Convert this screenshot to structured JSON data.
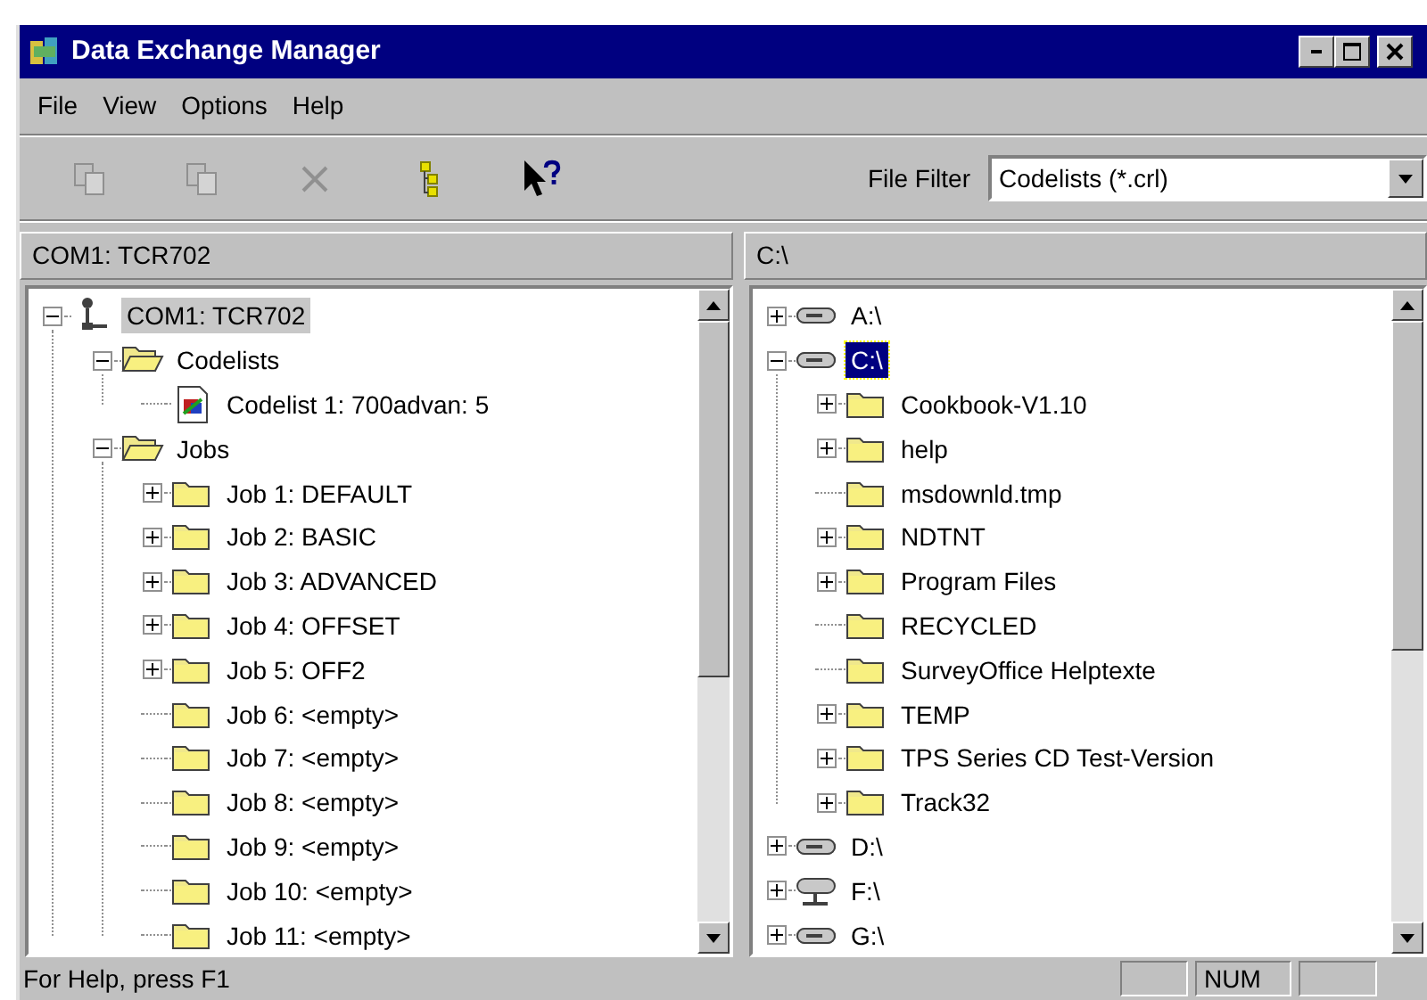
{
  "window": {
    "title": "Data Exchange Manager"
  },
  "menu": [
    {
      "label": "File"
    },
    {
      "label": "View"
    },
    {
      "label": "Options"
    },
    {
      "label": "Help"
    }
  ],
  "toolbar": [
    {
      "kind": "copy-left",
      "disabled": true
    },
    {
      "kind": "copy-right",
      "disabled": true
    },
    {
      "kind": "delete",
      "disabled": true
    },
    {
      "kind": "tree",
      "disabled": false
    },
    {
      "kind": "help",
      "disabled": false
    }
  ],
  "file_filter": {
    "label": "File Filter",
    "value": "Codelists (*.crl)"
  },
  "panes": [
    {
      "header": "COM1: TCR702",
      "focused": false,
      "tree": [
        {
          "label": "COM1: TCR702",
          "kind": "device",
          "selected": true,
          "expanded": true,
          "children": [
            {
              "label": "Codelists",
              "kind": "open-folder",
              "selected": false,
              "expanded": true,
              "children": [
                {
                  "label": "Codelist 1: 700advan: 5",
                  "kind": "codelist",
                  "selected": false
                }
              ]
            },
            {
              "label": "Jobs",
              "kind": "open-folder",
              "selected": false,
              "expanded": true,
              "children": [
                {
                  "label": "Job 1: DEFAULT",
                  "kind": "folder",
                  "selected": false,
                  "expanded": false
                },
                {
                  "label": "Job 2: BASIC",
                  "kind": "folder",
                  "selected": false,
                  "expanded": false
                },
                {
                  "label": "Job 3: ADVANCED",
                  "kind": "folder",
                  "selected": false,
                  "expanded": false
                },
                {
                  "label": "Job 4: OFFSET",
                  "kind": "folder",
                  "selected": false,
                  "expanded": false
                },
                {
                  "label": "Job 5: OFF2",
                  "kind": "folder",
                  "selected": false,
                  "expanded": false
                },
                {
                  "label": "Job 6: <empty>",
                  "kind": "folder",
                  "selected": false
                },
                {
                  "label": "Job 7: <empty>",
                  "kind": "folder",
                  "selected": false
                },
                {
                  "label": "Job 8: <empty>",
                  "kind": "folder",
                  "selected": false
                },
                {
                  "label": "Job 9: <empty>",
                  "kind": "folder",
                  "selected": false
                },
                {
                  "label": "Job 10: <empty>",
                  "kind": "folder",
                  "selected": false
                },
                {
                  "label": "Job 11: <empty>",
                  "kind": "folder",
                  "selected": false
                }
              ]
            }
          ]
        }
      ]
    },
    {
      "header": "C:\\",
      "focused": true,
      "tree": [
        {
          "label": "A:\\",
          "kind": "drive",
          "selected": false,
          "expanded": false
        },
        {
          "label": "C:\\",
          "kind": "drive",
          "selected": true,
          "expanded": true,
          "children": [
            {
              "label": "Cookbook-V1.10",
              "kind": "folder",
              "selected": false,
              "expanded": false
            },
            {
              "label": "help",
              "kind": "folder",
              "selected": false,
              "expanded": false
            },
            {
              "label": "msdownld.tmp",
              "kind": "folder",
              "selected": false
            },
            {
              "label": "NDTNT",
              "kind": "folder",
              "selected": false,
              "expanded": false
            },
            {
              "label": "Program Files",
              "kind": "folder",
              "selected": false,
              "expanded": false
            },
            {
              "label": "RECYCLED",
              "kind": "folder",
              "selected": false
            },
            {
              "label": "SurveyOffice Helptexte",
              "kind": "folder",
              "selected": false
            },
            {
              "label": "TEMP",
              "kind": "folder",
              "selected": false,
              "expanded": false
            },
            {
              "label": "TPS Series CD Test-Version",
              "kind": "folder",
              "selected": false,
              "expanded": false
            },
            {
              "label": "Track32",
              "kind": "folder",
              "selected": false,
              "expanded": false
            }
          ]
        },
        {
          "label": "D:\\",
          "kind": "drive",
          "selected": false,
          "expanded": false
        },
        {
          "label": "F:\\",
          "kind": "network-drive",
          "selected": false,
          "expanded": false
        },
        {
          "label": "G:\\",
          "kind": "drive",
          "selected": false,
          "expanded": false
        }
      ]
    }
  ],
  "status_bar": {
    "text": "For Help, press F1",
    "panels": [
      {
        "kind": "blank"
      },
      {
        "kind": "text",
        "text": "NUM"
      },
      {
        "kind": "blank"
      }
    ]
  }
}
